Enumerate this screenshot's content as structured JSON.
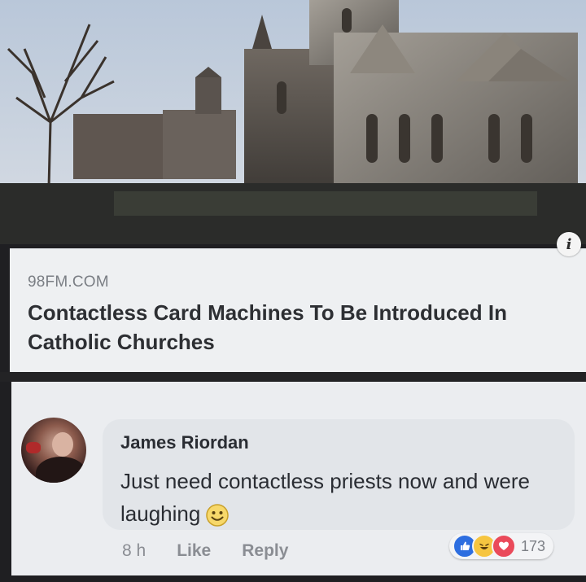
{
  "photo": {
    "alt": "Cathedral exterior photo",
    "info_icon": "info-icon"
  },
  "link": {
    "domain": "98FM.COM",
    "title": "Contactless Card Machines To Be Introduced In Catholic Churches"
  },
  "comment": {
    "author": "James Riordan",
    "text": "Just need contactless priests now and were laughing",
    "emoji": "smiling-face-emoji",
    "time": "8 h",
    "like_label": "Like",
    "reply_label": "Reply",
    "reactions": {
      "icons": [
        "like-reaction-icon",
        "haha-reaction-icon",
        "love-reaction-icon"
      ],
      "count": "173"
    }
  },
  "colors": {
    "like_blue": "#2d6ee0",
    "haha_yellow": "#f6c540",
    "love_red": "#ea4a5a"
  }
}
